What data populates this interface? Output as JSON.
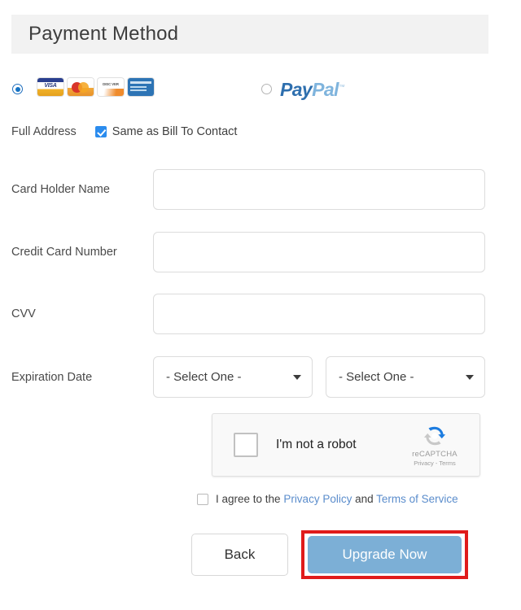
{
  "header": {
    "title": "Payment Method"
  },
  "payment_types": {
    "card": {
      "selected": true,
      "icons": [
        "visa-card-icon",
        "mastercard-card-icon",
        "discover-card-icon",
        "amex-card-icon"
      ],
      "icon_labels": [
        "VISA",
        "Mastercard",
        "Discover",
        "American Express"
      ]
    },
    "paypal": {
      "selected": false,
      "logo_part1": "Pay",
      "logo_part2": "Pal",
      "trademark": "™"
    }
  },
  "address": {
    "label": "Full Address",
    "same_as_label": "Same as Bill To Contact",
    "same_as_checked": true
  },
  "fields": {
    "card_holder_name": {
      "label": "Card Holder Name",
      "value": "",
      "placeholder": ""
    },
    "credit_card_number": {
      "label": "Credit Card Number",
      "value": "",
      "placeholder": ""
    },
    "cvv": {
      "label": "CVV",
      "value": "",
      "placeholder": ""
    },
    "expiration_date": {
      "label": "Expiration Date",
      "month_selected": "- Select One -",
      "year_selected": "- Select One -"
    }
  },
  "recaptcha": {
    "checkbox_label": "I'm not a robot",
    "checked": false,
    "brand": "reCAPTCHA",
    "legal": "Privacy - Terms"
  },
  "agreement": {
    "checked": false,
    "prefix": "I agree to the ",
    "privacy_link": "Privacy Policy",
    "middle": " and ",
    "terms_link": "Terms of Service"
  },
  "buttons": {
    "back": "Back",
    "upgrade": "Upgrade Now"
  },
  "colors": {
    "header_bg": "#f2f2f2",
    "accent_blue": "#7cafd6",
    "link_blue": "#5b8dcc",
    "checkbox_blue": "#2b8cee",
    "highlight_red": "#e01b1b"
  }
}
